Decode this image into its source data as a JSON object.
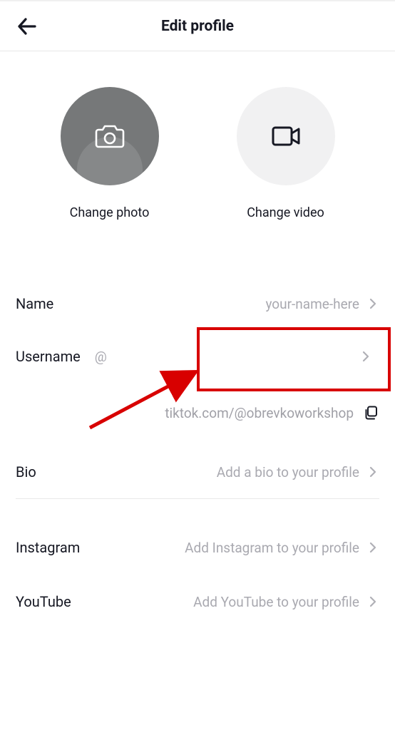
{
  "header": {
    "title": "Edit profile"
  },
  "media": {
    "photo_label": "Change photo",
    "video_label": "Change video"
  },
  "fields": {
    "name": {
      "label": "Name",
      "value": "your-name-here"
    },
    "username": {
      "label": "Username",
      "value": "@"
    },
    "url": "tiktok.com/@obrevkoworkshop",
    "bio": {
      "label": "Bio",
      "placeholder": "Add a bio to your profile"
    }
  },
  "socials": {
    "instagram": {
      "label": "Instagram",
      "placeholder": "Add Instagram to your profile"
    },
    "youtube": {
      "label": "YouTube",
      "placeholder": "Add YouTube to your profile"
    }
  }
}
